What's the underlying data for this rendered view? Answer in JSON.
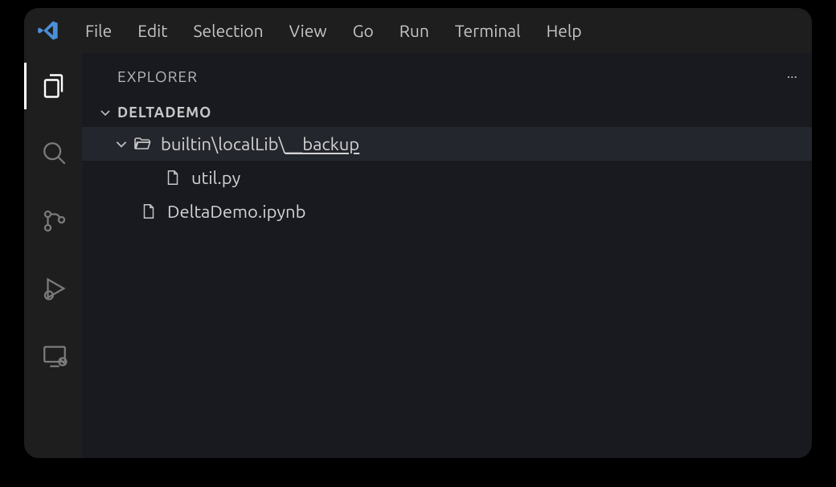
{
  "menus": {
    "file": "File",
    "edit": "Edit",
    "selection": "Selection",
    "view": "View",
    "go": "Go",
    "run": "Run",
    "terminal": "Terminal",
    "help": "Help"
  },
  "sidebar": {
    "title": "EXPLORER",
    "workspace": "DELTADEMO"
  },
  "tree": {
    "folder": {
      "seg1": "builtin",
      "seg2": "localLib",
      "seg3": "__backup",
      "sep": "\\"
    },
    "files": [
      {
        "name": "util.py"
      },
      {
        "name": "DeltaDemo.ipynb"
      }
    ]
  }
}
